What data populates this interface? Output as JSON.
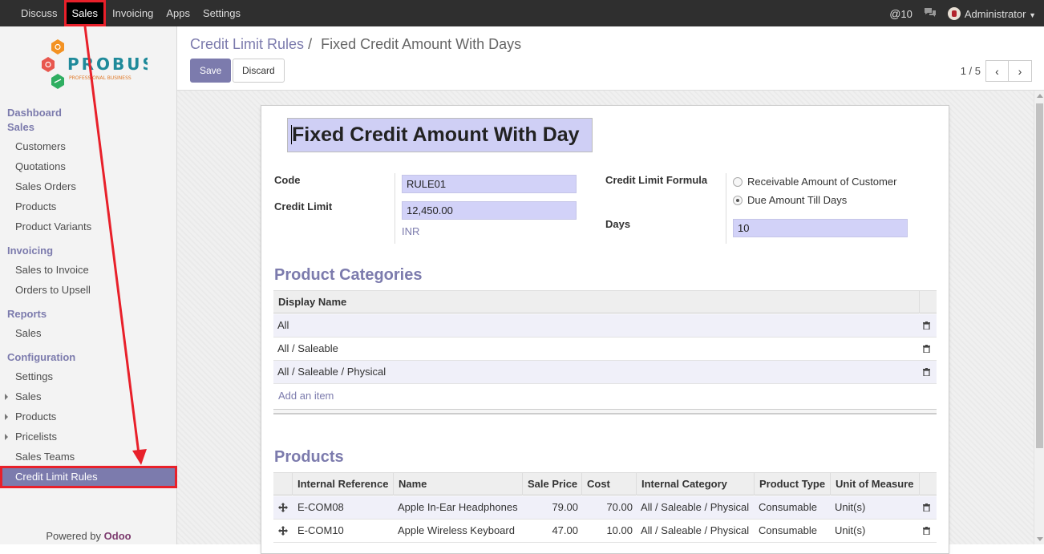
{
  "topbar": {
    "menu": [
      "Discuss",
      "Sales",
      "Invoicing",
      "Apps",
      "Settings"
    ],
    "messages_count": "10",
    "user": "Administrator"
  },
  "logo": {
    "brand": "PROBUSE",
    "tagline": "PROFESSIONAL BUSINESS"
  },
  "sidebar": {
    "section_dashboard": "Dashboard",
    "section_sales": "Sales",
    "sales_items": [
      "Customers",
      "Quotations",
      "Sales Orders",
      "Products",
      "Product Variants"
    ],
    "section_invoicing": "Invoicing",
    "invoicing_items": [
      "Sales to Invoice",
      "Orders to Upsell"
    ],
    "section_reports": "Reports",
    "reports_items": [
      "Sales"
    ],
    "section_configuration": "Configuration",
    "config_items": [
      "Settings",
      "Sales",
      "Products",
      "Pricelists",
      "Sales Teams"
    ],
    "active_item": "Credit Limit Rules",
    "powered_prefix": "Powered by ",
    "powered_brand": "Odoo"
  },
  "control": {
    "breadcrumb_parent": "Credit Limit Rules",
    "breadcrumb_sep": "/",
    "breadcrumb_current": "Fixed Credit Amount With Days",
    "save_label": "Save",
    "discard_label": "Discard",
    "pager_value": "1 / 5"
  },
  "form": {
    "name": "Fixed Credit Amount With Day",
    "code_label": "Code",
    "code_value": "RULE01",
    "credit_limit_label": "Credit Limit",
    "credit_limit_value": "12,450.00",
    "currency": "INR",
    "formula_label": "Credit Limit Formula",
    "formula_options": [
      "Receivable Amount of Customer",
      "Due Amount Till Days"
    ],
    "formula_selected": "Due Amount Till Days",
    "days_label": "Days",
    "days_value": "10"
  },
  "categories": {
    "title": "Product Categories",
    "header": "Display Name",
    "rows": [
      "All",
      "All / Saleable",
      "All / Saleable / Physical"
    ],
    "add_item": "Add an item"
  },
  "products": {
    "title": "Products",
    "headers": [
      "Internal Reference",
      "Name",
      "Sale Price",
      "Cost",
      "Internal Category",
      "Product Type",
      "Unit of Measure"
    ],
    "rows": [
      {
        "ref": "E-COM08",
        "name": "Apple In-Ear Headphones",
        "price": "79.00",
        "cost": "70.00",
        "category": "All / Saleable / Physical",
        "type": "Consumable",
        "uom": "Unit(s)"
      },
      {
        "ref": "E-COM10",
        "name": "Apple Wireless Keyboard",
        "price": "47.00",
        "cost": "10.00",
        "category": "All / Saleable / Physical",
        "type": "Consumable",
        "uom": "Unit(s)"
      }
    ]
  },
  "colors": {
    "brand": "#7c7bad",
    "annotation": "#e8202a",
    "topbar": "#2f2f2f"
  },
  "annotation": {
    "arrow": "red arrow from Sales menu to Credit Limit Rules"
  }
}
